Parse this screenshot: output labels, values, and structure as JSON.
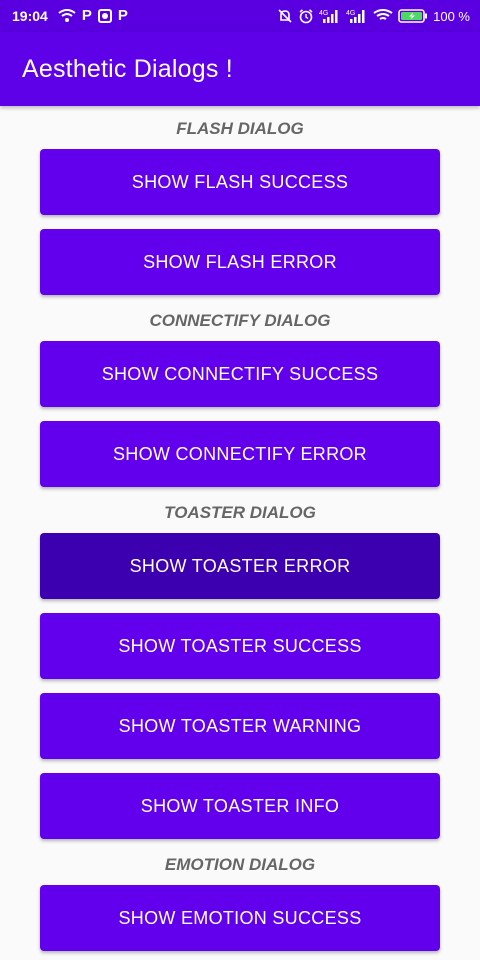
{
  "status_bar": {
    "time": "19:04",
    "network_left": "4G",
    "network_right": "4G",
    "battery_percent": "100 %"
  },
  "app_bar": {
    "title": "Aesthetic Dialogs !"
  },
  "sections": {
    "flash": {
      "label": "FLASH DIALOG",
      "buttons": [
        "SHOW FLASH SUCCESS",
        "SHOW FLASH ERROR"
      ]
    },
    "connectify": {
      "label": "CONNECTIFY DIALOG",
      "buttons": [
        "SHOW CONNECTIFY SUCCESS",
        "SHOW CONNECTIFY ERROR"
      ]
    },
    "toaster": {
      "label": "TOASTER DIALOG",
      "buttons": [
        "SHOW TOASTER ERROR",
        "SHOW TOASTER SUCCESS",
        "SHOW TOASTER WARNING",
        "SHOW TOASTER INFO"
      ]
    },
    "emotion": {
      "label": "EMOTION DIALOG",
      "buttons": [
        "SHOW EMOTION SUCCESS"
      ]
    }
  },
  "colors": {
    "primary": "#6200ee",
    "primary_pressed": "#3d00b0",
    "app_bar": "#5e00e8",
    "section_label": "#666666"
  }
}
